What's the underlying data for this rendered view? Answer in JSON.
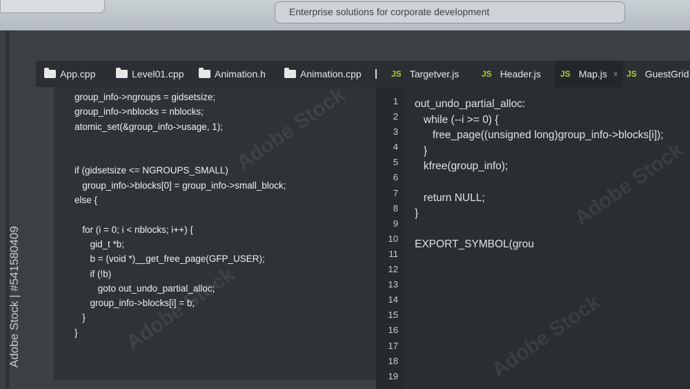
{
  "address_bar": {
    "text": "Enterprise solutions for corporate development"
  },
  "watermark": {
    "side_text": "Adobe Stock | #541580409",
    "overlay_text": "Adobe Stock"
  },
  "tabs": [
    {
      "label": "App.cpp",
      "icon": "folder-icon"
    },
    {
      "label": "Level01.cpp",
      "icon": "folder-icon"
    },
    {
      "label": "Animation.h",
      "icon": "folder-icon"
    },
    {
      "label": "Animation.cpp",
      "icon": "folder-icon"
    },
    {
      "label": "Targetver.js",
      "icon": "js-icon",
      "badge": "JS"
    },
    {
      "label": "Header.js",
      "icon": "js-icon",
      "badge": "JS"
    },
    {
      "label": "Map.js",
      "icon": "js-icon",
      "badge": "JS",
      "close": "x"
    },
    {
      "label": "GuestGrid.js",
      "icon": "js-icon",
      "badge": "JS"
    }
  ],
  "left_code": "group_info->ngroups = gidsetsize;\ngroup_info->nblocks = nblocks;\natomic_set(&group_info->usage, 1);\n\n\nif (gidsetsize <= NGROUPS_SMALL)\n   group_info->blocks[0] = group_info->small_block;\nelse {\n\n   for (i = 0; i < nblocks; i++) {\n      gid_t *b;\n      b = (void *)__get_free_page(GFP_USER);\n      if (!b)\n         goto out_undo_partial_alloc;\n      group_info->blocks[i] = b;\n   }\n}",
  "line_numbers": "1\n2\n3\n4\n5\n6\n7\n8\n9\n10\n11\n12\n13\n14\n15\n16\n17\n18\n19",
  "right_code": "out_undo_partial_alloc:\n   while (--i >= 0) {\n      free_page((unsigned long)group_info->blocks[i]);\n   }\n   kfree(group_info);\n\n   return NULL;\n}\n\nEXPORT_SYMBOL(grou",
  "colors": {
    "js_badge": "#a9d13a",
    "code_text": "#f0f0f0",
    "editor_bg": "#2a2e32"
  }
}
